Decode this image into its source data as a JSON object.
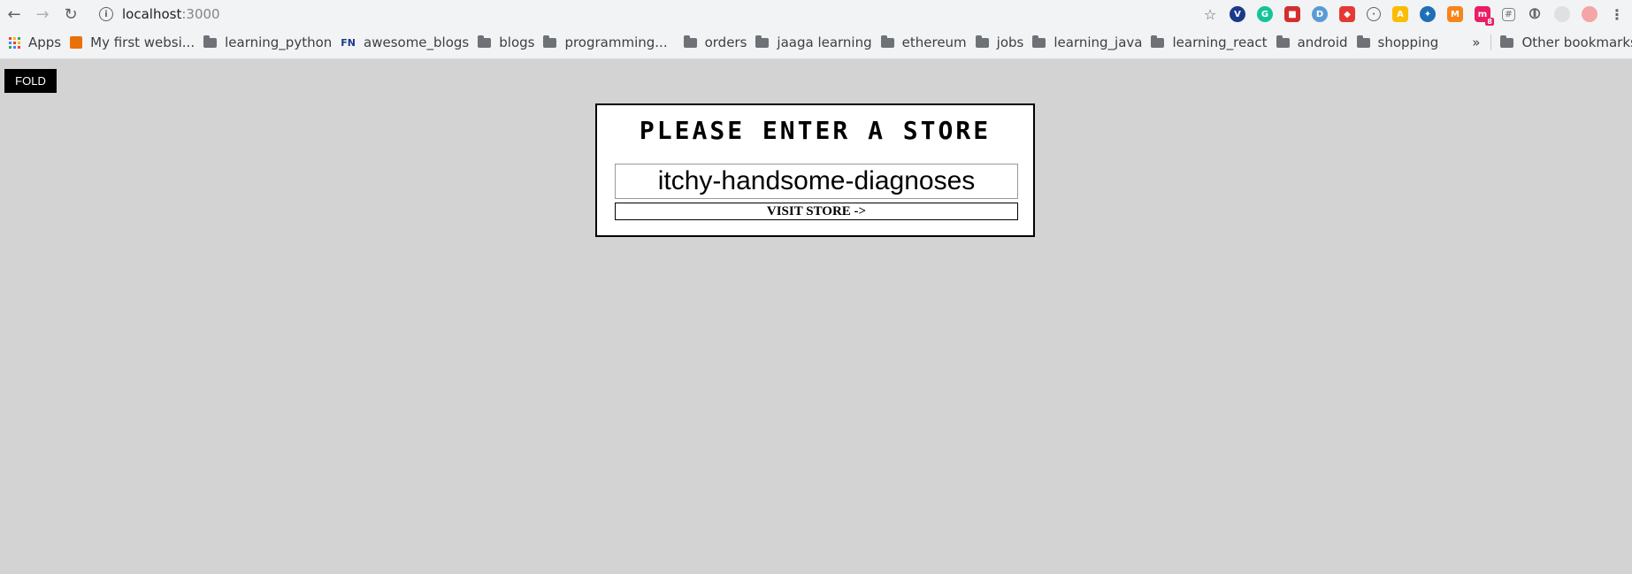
{
  "browser": {
    "url_host": "localhost",
    "url_port": ":3000",
    "bookmarks": [
      {
        "label": "Apps",
        "icon": "apps-grid-icon"
      },
      {
        "label": "My first websi...",
        "icon": "site-icon"
      },
      {
        "label": "learning_python",
        "icon": "folder-icon"
      },
      {
        "label": "awesome_blogs",
        "icon": "fn-icon"
      },
      {
        "label": "blogs",
        "icon": "folder-icon"
      },
      {
        "label": "programming...",
        "icon": "folder-icon"
      },
      {
        "label": "orders",
        "icon": "folder-icon"
      },
      {
        "label": "jaaga learning",
        "icon": "folder-icon"
      },
      {
        "label": "ethereum",
        "icon": "folder-icon"
      },
      {
        "label": "jobs",
        "icon": "folder-icon"
      },
      {
        "label": "learning_java",
        "icon": "folder-icon"
      },
      {
        "label": "learning_react",
        "icon": "folder-icon"
      },
      {
        "label": "android",
        "icon": "folder-icon"
      },
      {
        "label": "shopping",
        "icon": "folder-icon"
      }
    ],
    "more_bookmarks": "»",
    "other_bookmarks": "Other bookmarks",
    "fn_icon_text": "FN",
    "extension_badge": "8"
  },
  "page": {
    "fold_label": "FOLD",
    "title": "PLEASE ENTER A STORE",
    "store_value": "itchy-handsome-diagnoses",
    "visit_label": "VISIT STORE ->"
  }
}
